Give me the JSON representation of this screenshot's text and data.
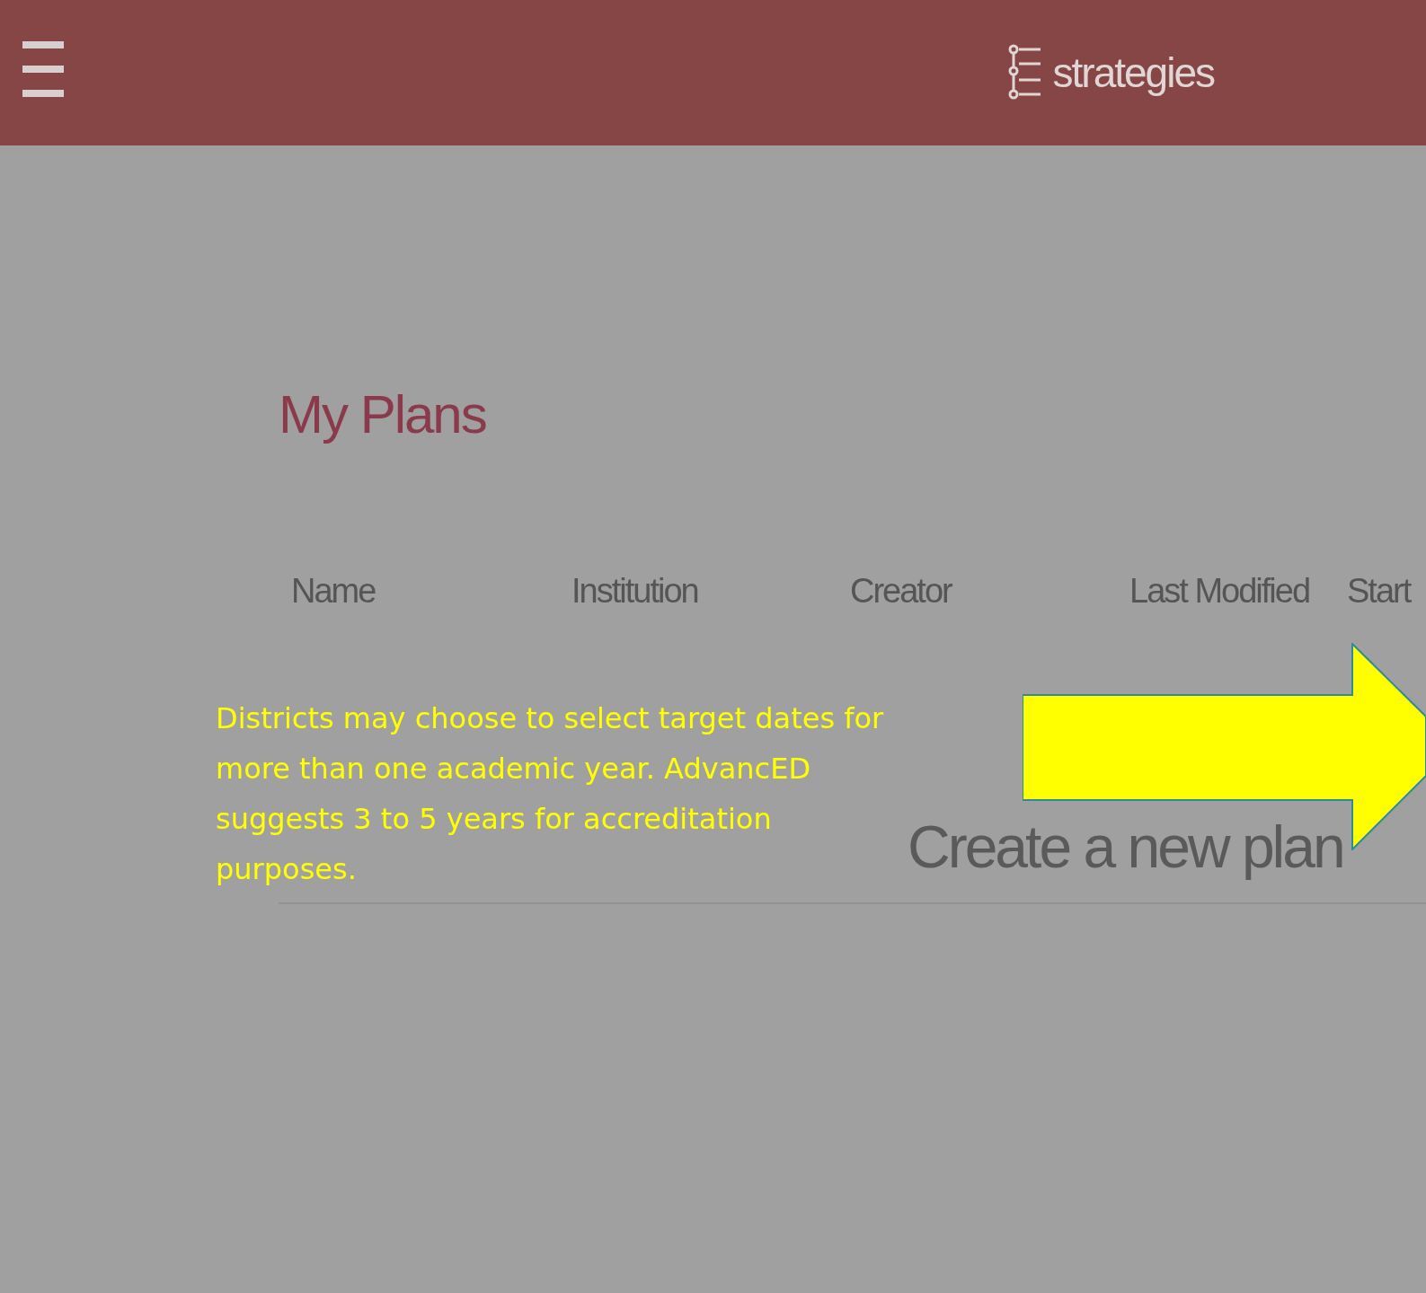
{
  "header": {
    "brand": "strategies"
  },
  "page": {
    "title": "My Plans"
  },
  "table": {
    "columns": [
      "Name",
      "Institution",
      "Creator",
      "Last Modified",
      "Start"
    ]
  },
  "create_link": "Create a new plan",
  "callout": {
    "text": "Districts may choose to select target dates for more than one academic year.  AdvancED suggests 3 to 5 years for accreditation purposes."
  }
}
